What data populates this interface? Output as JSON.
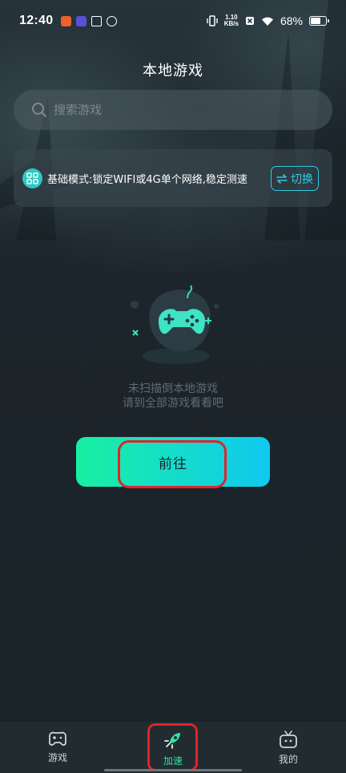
{
  "status_bar": {
    "time": "12:40",
    "net_speed_top": "1.10",
    "net_speed_bottom": "KB/s",
    "battery_percent": "68%",
    "battery_level": 0.68
  },
  "header": {
    "title": "本地游戏"
  },
  "search": {
    "placeholder": "搜索游戏"
  },
  "mode": {
    "text": "基础模式:锁定WIFI或4G单个网络,稳定测速",
    "switch_label": "切换",
    "accent_color": "#2ec9e4"
  },
  "empty_state": {
    "line1": "未扫描倒本地游戏",
    "line2": "请到全部游戏看看吧"
  },
  "go_button": {
    "label": "前往"
  },
  "tabbar": {
    "tabs": [
      {
        "label": "游戏",
        "icon": "gamepad-icon",
        "active": false
      },
      {
        "label": "加速",
        "icon": "rocket-icon",
        "active": true
      },
      {
        "label": "我的",
        "icon": "tv-robot-icon",
        "active": false
      }
    ],
    "active_color": "#2ee59a"
  }
}
